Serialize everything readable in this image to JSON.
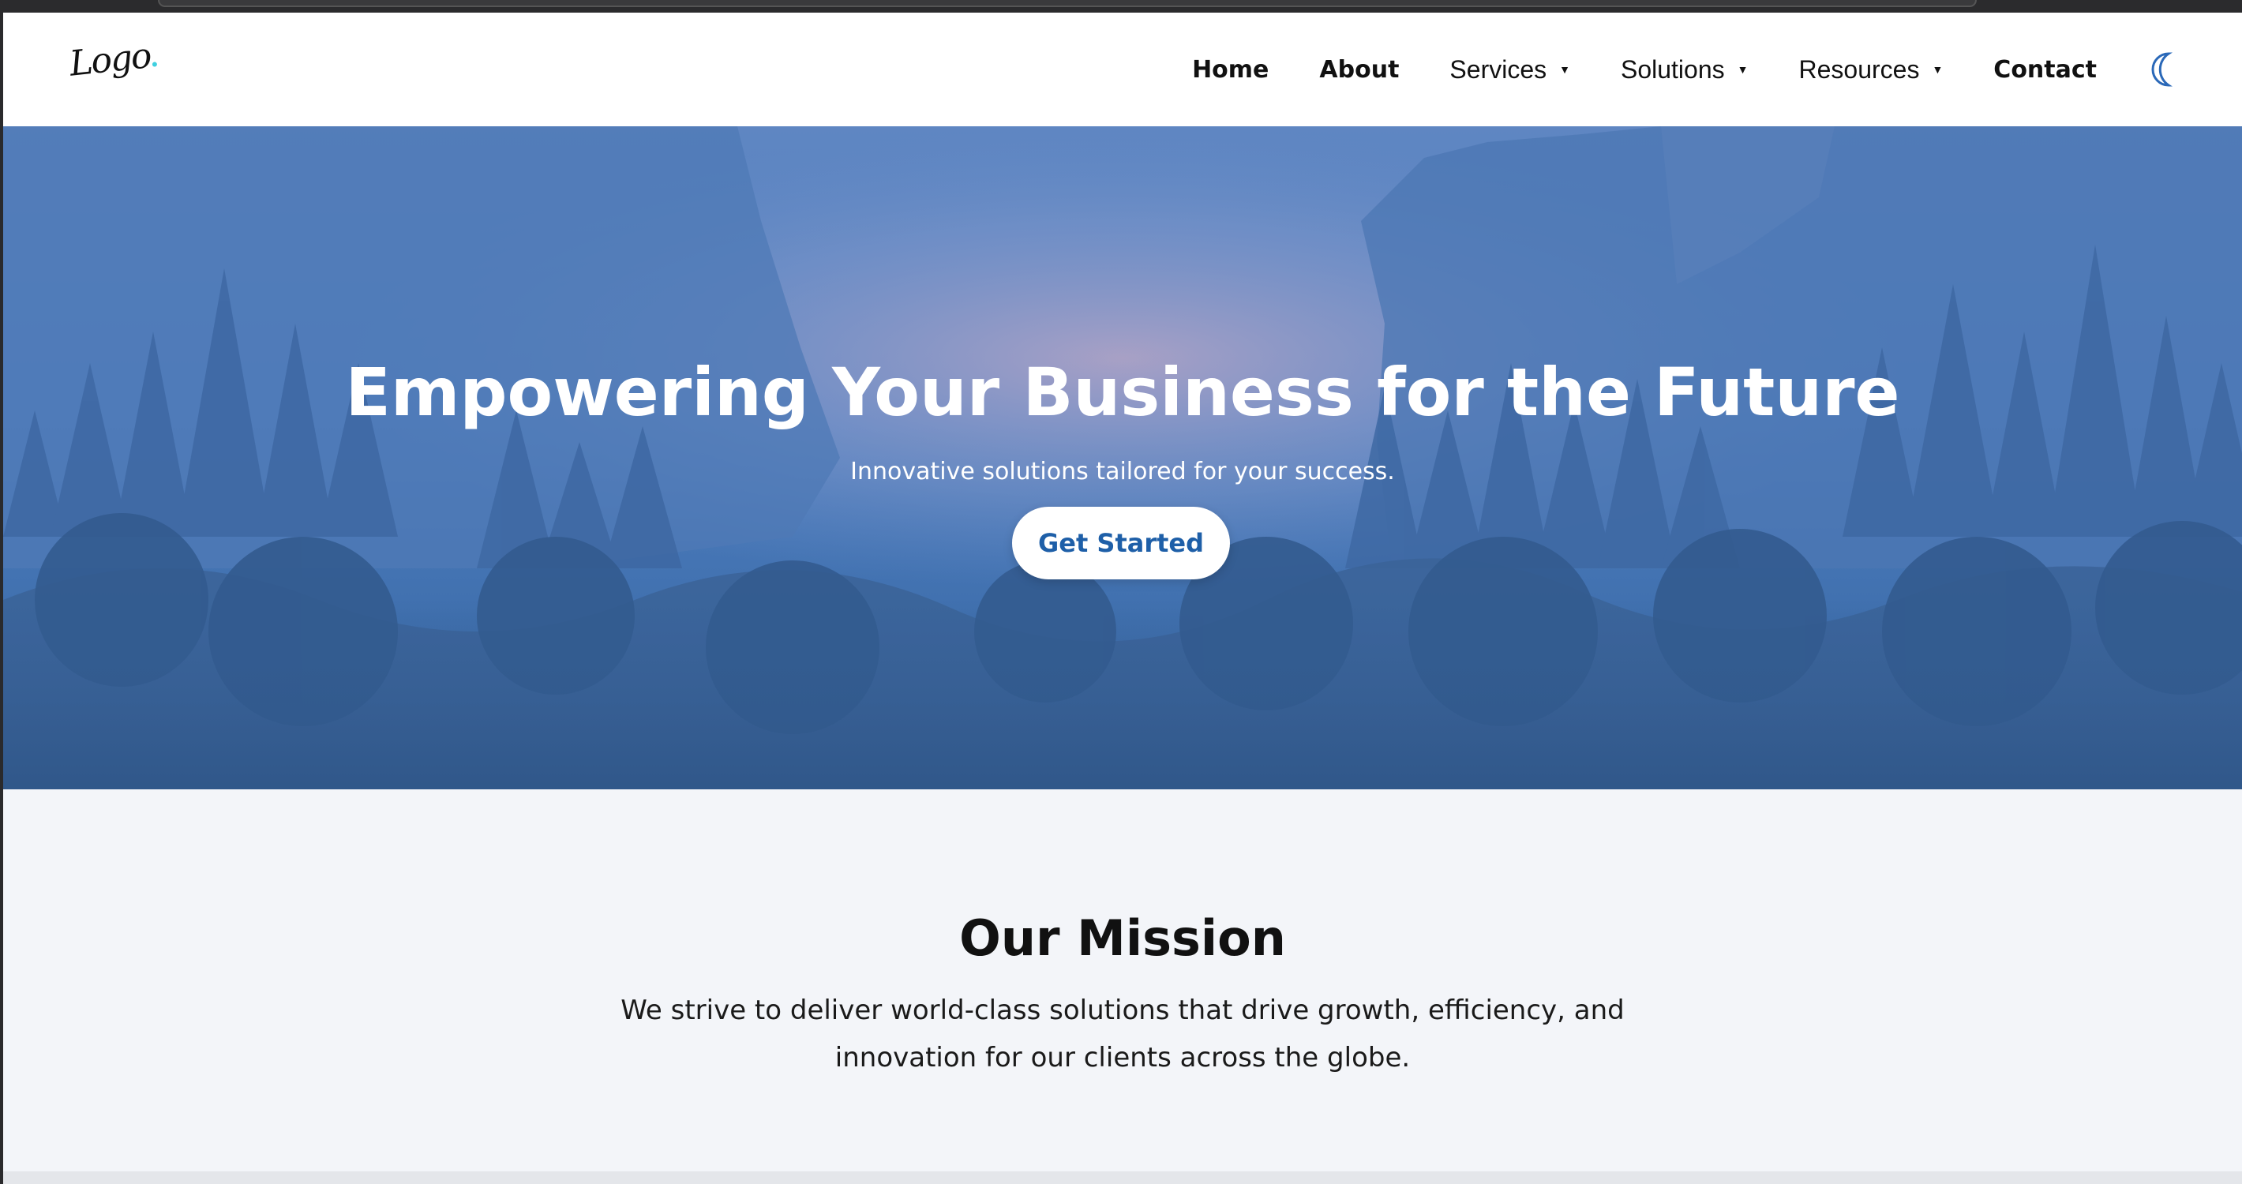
{
  "header": {
    "logo_text": "Logo",
    "nav": {
      "home": "Home",
      "about": "About",
      "services": "Services",
      "solutions": "Solutions",
      "resources": "Resources",
      "contact": "Contact"
    },
    "theme_toggle_icon": "moon-icon"
  },
  "hero": {
    "title": "Empowering Your Business for the Future",
    "subtitle": "Innovative solutions tailored for your success.",
    "cta_label": "Get Started",
    "overlay_color": "#4f7fc1"
  },
  "mission": {
    "title": "Our Mission",
    "text": "We strive to deliver world-class solutions that drive growth, efficiency, and innovation for our clients across the globe."
  },
  "colors": {
    "accent": "#1e5fa8",
    "logo_dot": "#3fd0e0",
    "section_bg": "#f3f5f9"
  }
}
